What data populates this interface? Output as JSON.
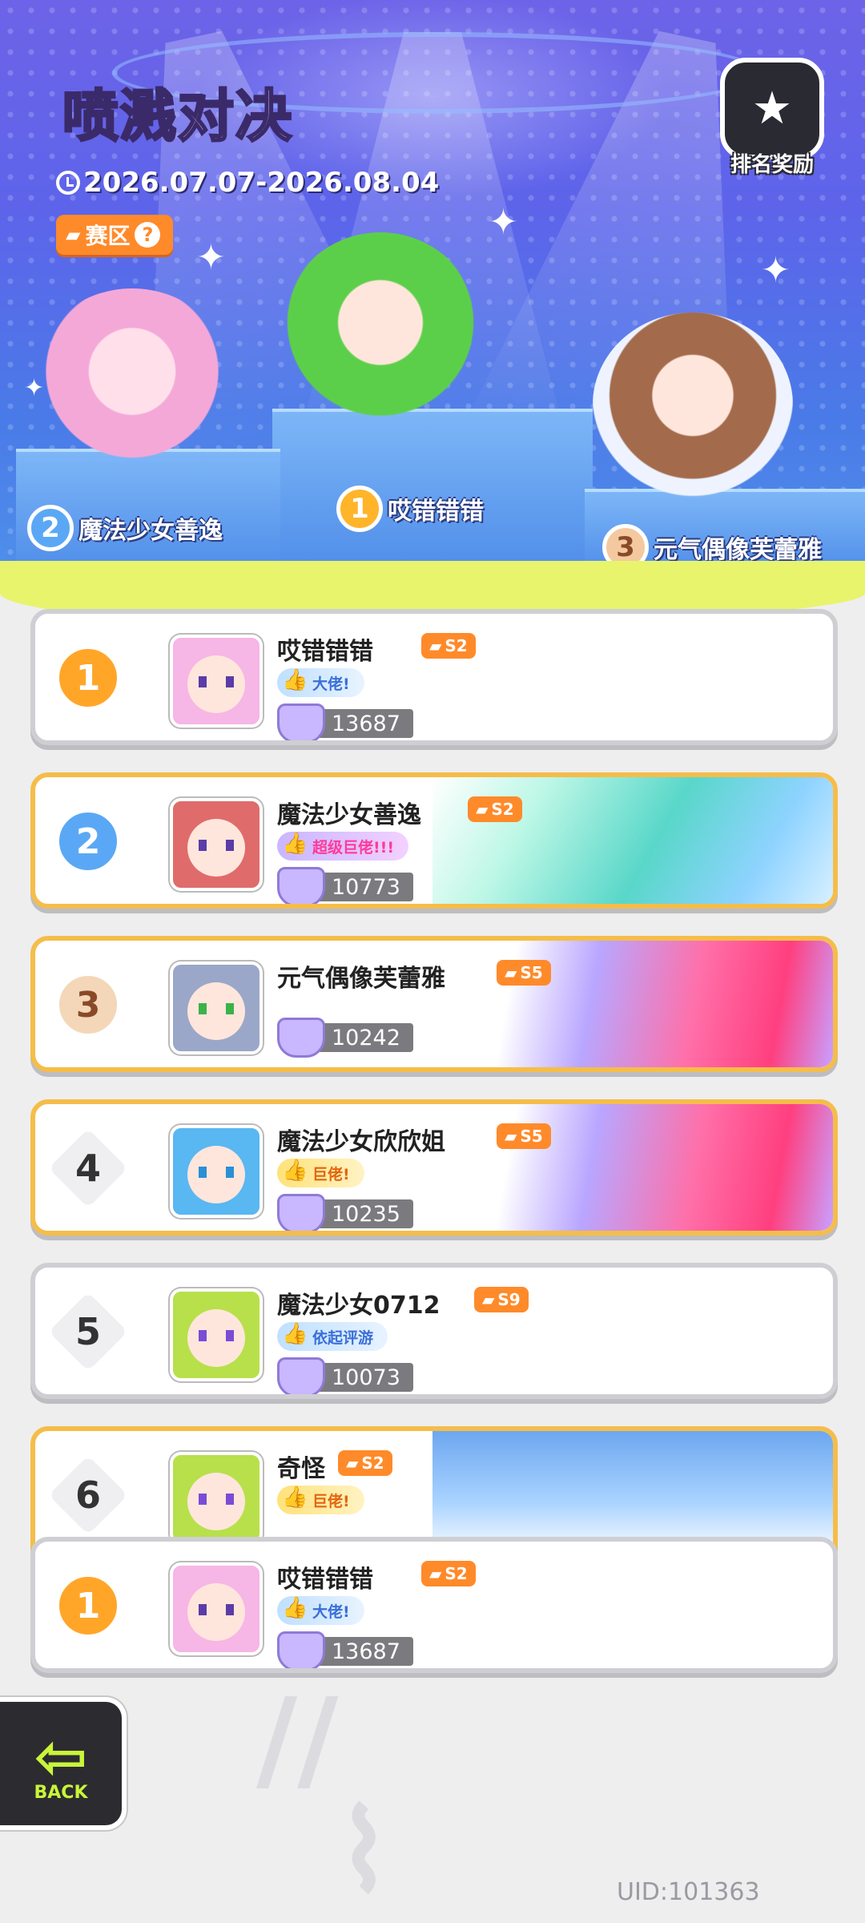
{
  "header": {
    "title_part1": "喷溅",
    "title_part2": "对决",
    "date_range": "2026.07.07-2026.08.04",
    "zone_label": "赛区",
    "zone_help": "?",
    "reward_label": "排名奖励"
  },
  "podium": [
    {
      "rank": "2",
      "name": "魔法少女善逸"
    },
    {
      "rank": "1",
      "name": "哎错错错"
    },
    {
      "rank": "3",
      "name": "元气偶像芙蕾雅"
    }
  ],
  "leaderboard": [
    {
      "rank": "1",
      "name": "哎错错错",
      "season": "S2",
      "title": "大佬!",
      "score": "13687"
    },
    {
      "rank": "2",
      "name": "魔法少女善逸",
      "season": "S2",
      "title": "超级巨佬!!!",
      "score": "10773"
    },
    {
      "rank": "3",
      "name": "元气偶像芙蕾雅",
      "season": "S5",
      "title": "",
      "score": "10242"
    },
    {
      "rank": "4",
      "name": "魔法少女欣欣姐",
      "season": "S5",
      "title": "巨佬!",
      "score": "10235"
    },
    {
      "rank": "5",
      "name": "魔法少女0712",
      "season": "S9",
      "title": "依起评游",
      "score": "10073"
    },
    {
      "rank": "6",
      "name": "奇怪",
      "season": "S2",
      "title": "巨佬!",
      "score": ""
    }
  ],
  "my_rank": {
    "rank": "1",
    "name": "哎错错错",
    "season": "S2",
    "title": "大佬!",
    "score": "13687"
  },
  "footer": {
    "back_label": "BACK",
    "uid": "UID:101363"
  },
  "colors": {
    "accent_orange": "#ff8a2a",
    "gold_border": "#f5bd49",
    "back_green": "#c9f53a"
  }
}
